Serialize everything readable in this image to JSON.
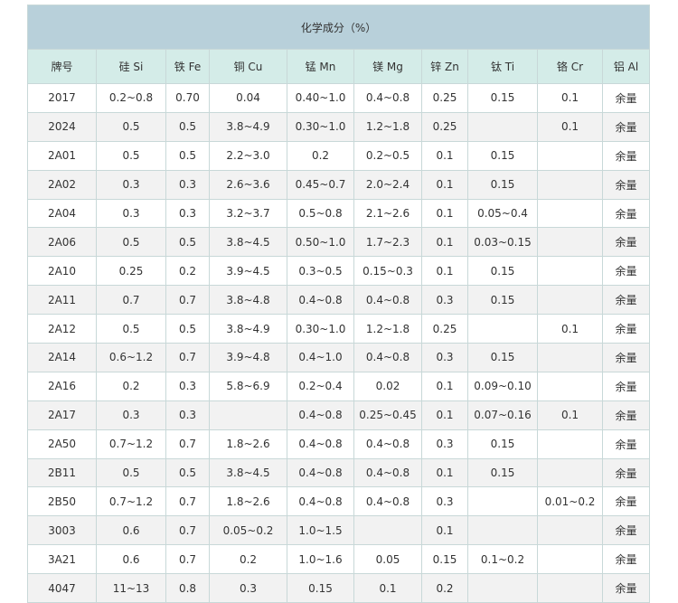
{
  "table": {
    "title": "化学成分（%）",
    "headers": [
      "牌号",
      "硅 Si",
      "铁 Fe",
      "铜 Cu",
      "锰 Mn",
      "镁 Mg",
      "锌 Zn",
      "钛 Ti",
      "铬 Cr",
      "铝 Al"
    ],
    "rows": [
      [
        "2017",
        "0.2~0.8",
        "0.70",
        "0.04",
        "0.40~1.0",
        "0.4~0.8",
        "0.25",
        "0.15",
        "0.1",
        "余量"
      ],
      [
        "2024",
        "0.5",
        "0.5",
        "3.8~4.9",
        "0.30~1.0",
        "1.2~1.8",
        "0.25",
        "",
        "0.1",
        "余量"
      ],
      [
        "2A01",
        "0.5",
        "0.5",
        "2.2~3.0",
        "0.2",
        "0.2~0.5",
        "0.1",
        "0.15",
        "",
        "余量"
      ],
      [
        "2A02",
        "0.3",
        "0.3",
        "2.6~3.6",
        "0.45~0.7",
        "2.0~2.4",
        "0.1",
        "0.15",
        "",
        "余量"
      ],
      [
        "2A04",
        "0.3",
        "0.3",
        "3.2~3.7",
        "0.5~0.8",
        "2.1~2.6",
        "0.1",
        "0.05~0.4",
        "",
        "余量"
      ],
      [
        "2A06",
        "0.5",
        "0.5",
        "3.8~4.5",
        "0.50~1.0",
        "1.7~2.3",
        "0.1",
        "0.03~0.15",
        "",
        "余量"
      ],
      [
        "2A10",
        "0.25",
        "0.2",
        "3.9~4.5",
        "0.3~0.5",
        "0.15~0.3",
        "0.1",
        "0.15",
        "",
        "余量"
      ],
      [
        "2A11",
        "0.7",
        "0.7",
        "3.8~4.8",
        "0.4~0.8",
        "0.4~0.8",
        "0.3",
        "0.15",
        "",
        "余量"
      ],
      [
        "2A12",
        "0.5",
        "0.5",
        "3.8~4.9",
        "0.30~1.0",
        "1.2~1.8",
        "0.25",
        "",
        "0.1",
        "余量"
      ],
      [
        "2A14",
        "0.6~1.2",
        "0.7",
        "3.9~4.8",
        "0.4~1.0",
        "0.4~0.8",
        "0.3",
        "0.15",
        "",
        "余量"
      ],
      [
        "2A16",
        "0.2",
        "0.3",
        "5.8~6.9",
        "0.2~0.4",
        "0.02",
        "0.1",
        "0.09~0.10",
        "",
        "余量"
      ],
      [
        "2A17",
        "0.3",
        "0.3",
        "",
        "0.4~0.8",
        "0.25~0.45",
        "0.1",
        "0.07~0.16",
        "0.1",
        "余量"
      ],
      [
        "2A50",
        "0.7~1.2",
        "0.7",
        "1.8~2.6",
        "0.4~0.8",
        "0.4~0.8",
        "0.3",
        "0.15",
        "",
        "余量"
      ],
      [
        "2B11",
        "0.5",
        "0.5",
        "3.8~4.5",
        "0.4~0.8",
        "0.4~0.8",
        "0.1",
        "0.15",
        "",
        "余量"
      ],
      [
        "2B50",
        "0.7~1.2",
        "0.7",
        "1.8~2.6",
        "0.4~0.8",
        "0.4~0.8",
        "0.3",
        "",
        "0.01~0.2",
        "余量"
      ],
      [
        "3003",
        "0.6",
        "0.7",
        "0.05~0.2",
        "1.0~1.5",
        "",
        "0.1",
        "",
        "",
        "余量"
      ],
      [
        "3A21",
        "0.6",
        "0.7",
        "0.2",
        "1.0~1.6",
        "0.05",
        "0.15",
        "0.1~0.2",
        "",
        "余量"
      ],
      [
        "4047",
        "11~13",
        "0.8",
        "0.3",
        "0.15",
        "0.1",
        "0.2",
        "",
        "",
        "余量"
      ]
    ]
  }
}
